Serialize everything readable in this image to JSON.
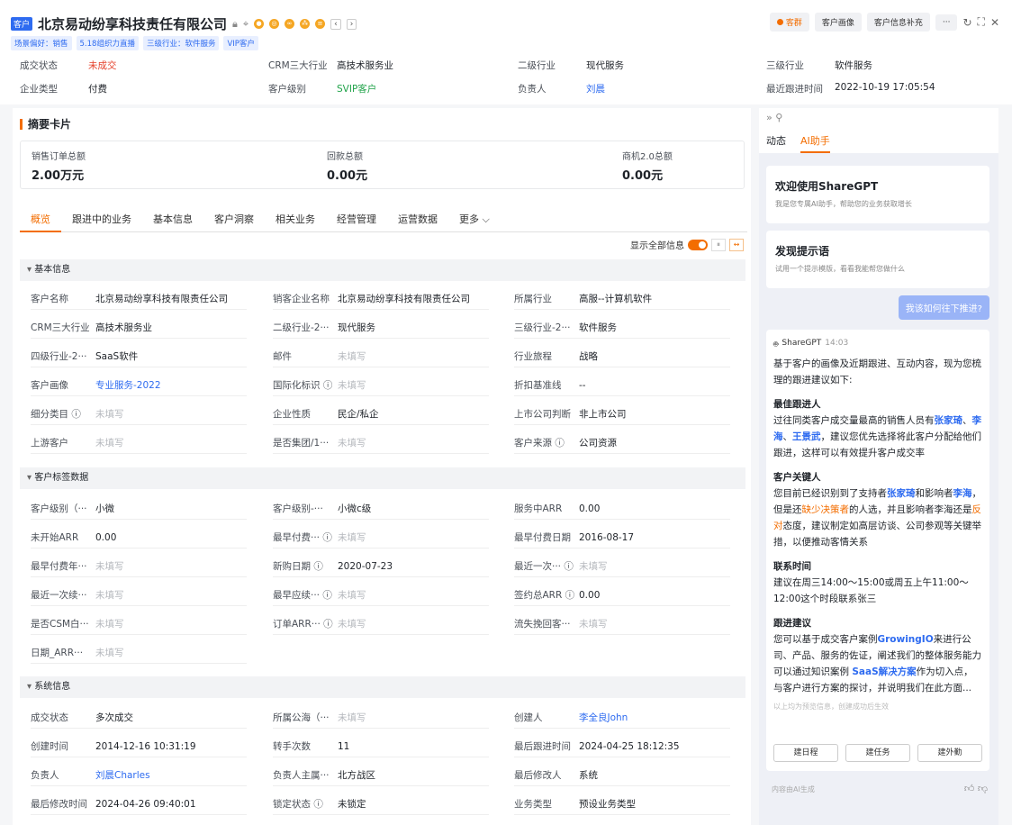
{
  "header": {
    "tag": "客户",
    "title": "北京易动纷享科技责任有限公司",
    "tags": [
      "场景偏好：销售",
      "5.18组织力直播",
      "三级行业：软件服务",
      "VIP客户"
    ],
    "actions": {
      "customer_pool": "客群",
      "portrait": "客户画像",
      "supplement": "客户信息补充"
    }
  },
  "top_fields": [
    {
      "k": "成交状态",
      "v": "未成交"
    },
    {
      "k": "CRM三大行业",
      "v": "高技术服务业"
    },
    {
      "k": "二级行业",
      "v": "现代服务"
    },
    {
      "k": "三级行业",
      "v": "软件服务"
    },
    {
      "k": "企业类型",
      "v": "付费"
    },
    {
      "k": "客户级别",
      "v": "SVIP客户"
    },
    {
      "k": "负责人",
      "v": "刘晨"
    },
    {
      "k": "最近跟进时间",
      "v": "2022-10-19 17:05:54"
    }
  ],
  "summary": {
    "title": "摘要卡片",
    "items": [
      {
        "k": "销售订单总额",
        "v": "2.00万元"
      },
      {
        "k": "回款总额",
        "v": "0.00元"
      },
      {
        "k": "商机2.0总额",
        "v": "0.00元"
      }
    ]
  },
  "tabs": [
    "概览",
    "跟进中的业务",
    "基本信息",
    "客户洞察",
    "相关业务",
    "经营管理",
    "运营数据",
    "更多 ⌵"
  ],
  "show_all": "显示全部信息",
  "sections": {
    "basic": "基本信息",
    "tags": "客户标签数据",
    "system": "系统信息"
  },
  "basic_fields": [
    [
      "客户名称",
      "北京易动纷享科技有限责任公司"
    ],
    [
      "销客企业名称",
      "北京易动纷享科技有限责任公司"
    ],
    [
      "所属行业",
      "高服--计算机软件"
    ],
    [
      "CRM三大行业",
      "高技术服务业"
    ],
    [
      "二级行业-2···",
      "现代服务"
    ],
    [
      "三级行业-2···",
      "软件服务"
    ],
    [
      "四级行业-2···",
      "SaaS软件"
    ],
    [
      "邮件",
      "未填写"
    ],
    [
      "行业旅程",
      "战略"
    ],
    [
      "客户画像",
      "专业服务-2022"
    ],
    [
      "国际化标识 ⓘ",
      "未填写"
    ],
    [
      "折扣基准线",
      "--"
    ],
    [
      "细分类目 ⓘ",
      "未填写"
    ],
    [
      "企业性质",
      "民企/私企"
    ],
    [
      "上市公司判断",
      "非上市公司"
    ],
    [
      "上游客户",
      "未填写"
    ],
    [
      "是否集团/1···",
      "未填写"
    ],
    [
      "客户来源 ⓘ",
      "公司资源"
    ]
  ],
  "tag_fields": [
    [
      "客户级别（···",
      "小微"
    ],
    [
      "客户级别-···",
      "小微c级"
    ],
    [
      "服务中ARR",
      "0.00"
    ],
    [
      "未开始ARR",
      "0.00"
    ],
    [
      "最早付费··· ⓘ",
      "未填写"
    ],
    [
      "最早付费日期",
      "2016-08-17"
    ],
    [
      "最早付费年···",
      "未填写"
    ],
    [
      "新购日期 ⓘ",
      "2020-07-23"
    ],
    [
      "最近一次··· ⓘ",
      "未填写"
    ],
    [
      "最近一次续···",
      "未填写"
    ],
    [
      "最早应续··· ⓘ",
      "未填写"
    ],
    [
      "签约总ARR ⓘ",
      "0.00"
    ],
    [
      "是否CSM白···",
      "未填写"
    ],
    [
      "订单ARR··· ⓘ",
      "未填写"
    ],
    [
      "流失挽回客···",
      "未填写"
    ],
    [
      "日期_ARR···",
      "未填写"
    ]
  ],
  "system_fields": [
    [
      "成交状态",
      "多次成交"
    ],
    [
      "所属公海（···",
      "未填写"
    ],
    [
      "创建人",
      "李全良John"
    ],
    [
      "创建时间",
      "2014-12-16 10:31:19"
    ],
    [
      "转手次数",
      "11"
    ],
    [
      "最后跟进时间",
      "2024-04-25 18:12:35"
    ],
    [
      "负责人",
      "刘晨Charles"
    ],
    [
      "负责人主属···",
      "北方战区"
    ],
    [
      "最后修改人",
      "系统"
    ],
    [
      "最后修改时间",
      "2024-04-26 09:40:01"
    ],
    [
      "锁定状态 ⓘ",
      "未锁定"
    ],
    [
      "业务类型",
      "预设业务类型"
    ]
  ],
  "right": {
    "tabs": [
      "动态",
      "AI助手"
    ],
    "welcome_title": "欢迎使用ShareGPT",
    "welcome_sub": "我是您专属AI助手，帮助您的业务获取增长",
    "prompt_title": "发现提示语",
    "prompt_sub": "试用一个提示模版，看看我能帮您做什么",
    "question": "我该如何往下推进?",
    "bot": "ShareGPT",
    "time": "14:03",
    "intro": "基于客户的画像及近期跟进、互动内容，现为您梳理的跟进建议如下:",
    "h1": "最佳跟进人",
    "h2": "客户关键人",
    "h3": "联系时间",
    "p3": "建议在周三14:00～15:00或周五上午11:00～12:00这个时段联系张三",
    "h4": "跟进建议",
    "note": "以上均为预览信息，创建成功后生效",
    "btns": [
      "建日程",
      "建任务",
      "建外勤"
    ],
    "foot": "内容由AI生成"
  }
}
